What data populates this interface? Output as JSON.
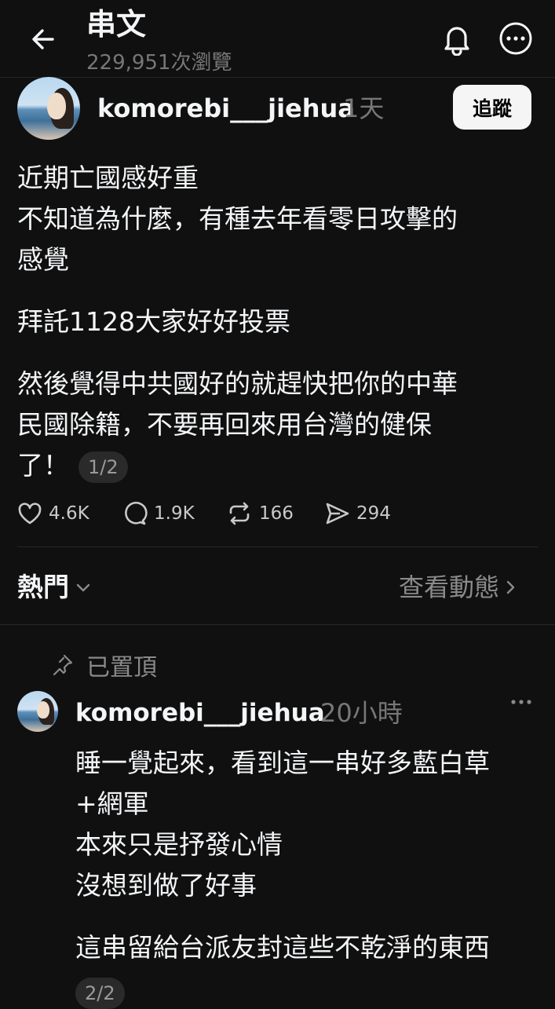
{
  "header": {
    "title": "串文",
    "views": "229,951次瀏覽"
  },
  "post": {
    "author": "komorebi___jiehua",
    "time": "1天",
    "follow_label": "追蹤",
    "lines": [
      "近期亡國感好重",
      "不知道為什麼，有種去年看零日攻擊的",
      "感覺",
      "",
      "拜託1128大家好好投票",
      "",
      "然後覺得中共國好的就趕快把你的中華",
      "民國除籍，不要再回來用台灣的健保",
      "了！"
    ],
    "page_indicator": "1/2",
    "stats": {
      "likes": "4.6K",
      "replies": "1.9K",
      "reposts": "166",
      "shares": "294"
    }
  },
  "sort": {
    "label": "熱門",
    "activity_label": "查看動態"
  },
  "pinned": {
    "label": "已置頂",
    "author": "komorebi___jiehua",
    "time": "20小時",
    "lines": [
      "睡一覺起來，看到這一串好多藍白草",
      "+網軍",
      "本來只是抒發心情",
      "沒想到做了好事",
      "",
      "這串留給台派友封這些不乾淨的東西"
    ],
    "page_indicator": "2/2"
  },
  "colors": {
    "background": "#101010",
    "text": "#f3f5f7",
    "secondary": "#777777",
    "divider": "#262626"
  }
}
